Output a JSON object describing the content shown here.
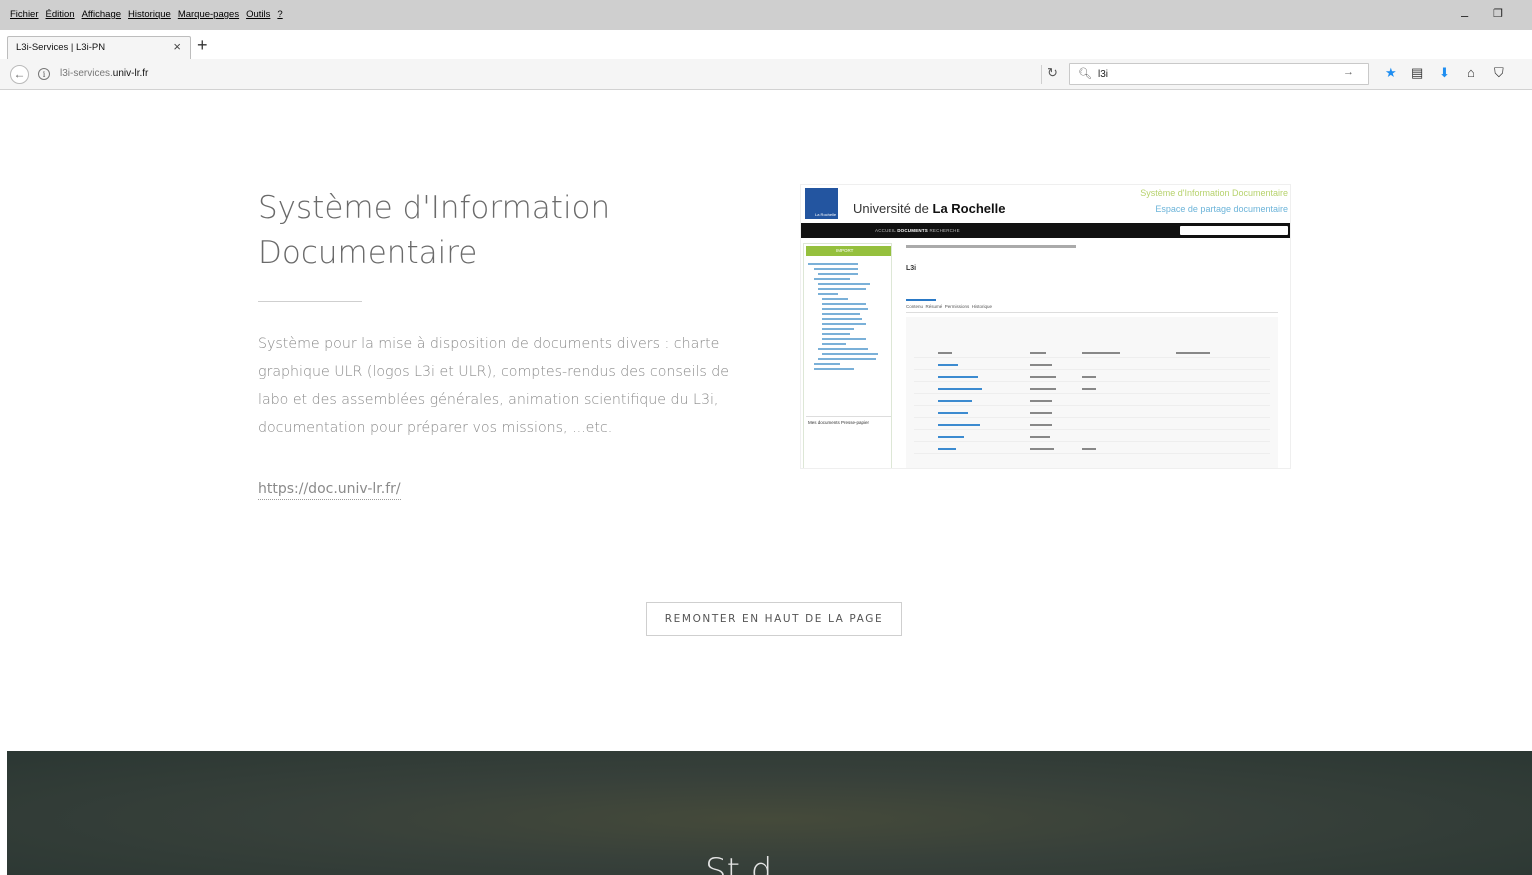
{
  "menubar": {
    "items": [
      "Fichier",
      "Édition",
      "Affichage",
      "Historique",
      "Marque-pages",
      "Outils",
      "?"
    ]
  },
  "tab": {
    "title": "L3i-Services | L3i-PN",
    "close": "×",
    "new": "+"
  },
  "navbar": {
    "url_prefix": "l3i-services.",
    "url_domain": "univ-lr.fr",
    "search_value": "l3i"
  },
  "content": {
    "title": "Système d'Information Documentaire",
    "description": "Système pour la mise à disposition de documents divers : charte graphique ULR (logos L3i et ULR), comptes-rendus des conseils de labo et des assemblées générales, animation scientifique du L3i, documentation pour préparer vos missions, ...etc.",
    "link": "https://doc.univ-lr.fr/"
  },
  "screenshot": {
    "univ": "Université de",
    "univ_bold": "La Rochelle",
    "sys_title": "Système d'Information Documentaire",
    "sys_sub": "Espace de partage documentaire",
    "nav": "ACCUEIL",
    "nav_bold": "DOCUMENTS",
    "nav_after": "RECHERCHE",
    "import": "IMPORT",
    "l3i": "L3i",
    "tabs": "Contenu  Résumé  Permissions  Historique",
    "mydocs": "Mes documents  Presse-papier",
    "rows": [
      "Accueil",
      "Animation scientifique",
      "Assemblées Générales",
      "Avis scientifiques",
      "Communication",
      "Conseil de laboratoire",
      "Doctorants",
      "Missions"
    ]
  },
  "back_to_top": "REMONTER EN HAUT DE LA PAGE",
  "dark_section": {
    "title": "St d"
  }
}
